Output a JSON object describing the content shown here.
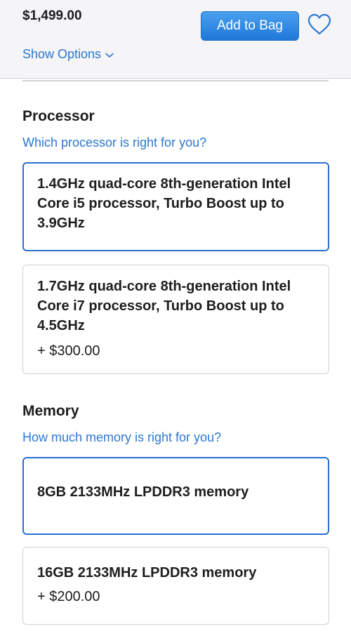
{
  "header": {
    "price": "$1,499.00",
    "add_to_bag_label": "Add to Bag",
    "show_options_label": "Show Options"
  },
  "processor": {
    "title": "Processor",
    "help_link": "Which processor is right for you?",
    "options": [
      {
        "name": "1.4GHz quad-core 8th-generation Intel Core i5 processor, Turbo Boost up to 3.9GHz",
        "price": "",
        "selected": true
      },
      {
        "name": "1.7GHz quad-core 8th-generation Intel Core i7 processor, Turbo Boost up to 4.5GHz",
        "price": "+ $300.00",
        "selected": false
      }
    ]
  },
  "memory": {
    "title": "Memory",
    "help_link": "How much memory is right for you?",
    "options": [
      {
        "name": "8GB 2133MHz LPDDR3 memory",
        "price": "",
        "selected": true
      },
      {
        "name": "16GB 2133MHz LPDDR3 memory",
        "price": "+ $200.00",
        "selected": false
      }
    ]
  },
  "colors": {
    "accent": "#2d77d0",
    "button": "#1f78d8",
    "selected_border": "#2b6fd0",
    "card_border": "#d2d2d7",
    "header_bg": "#f5f5f7"
  },
  "icons": {
    "favorite": "heart-icon",
    "show_options": "chevron-down-icon"
  }
}
